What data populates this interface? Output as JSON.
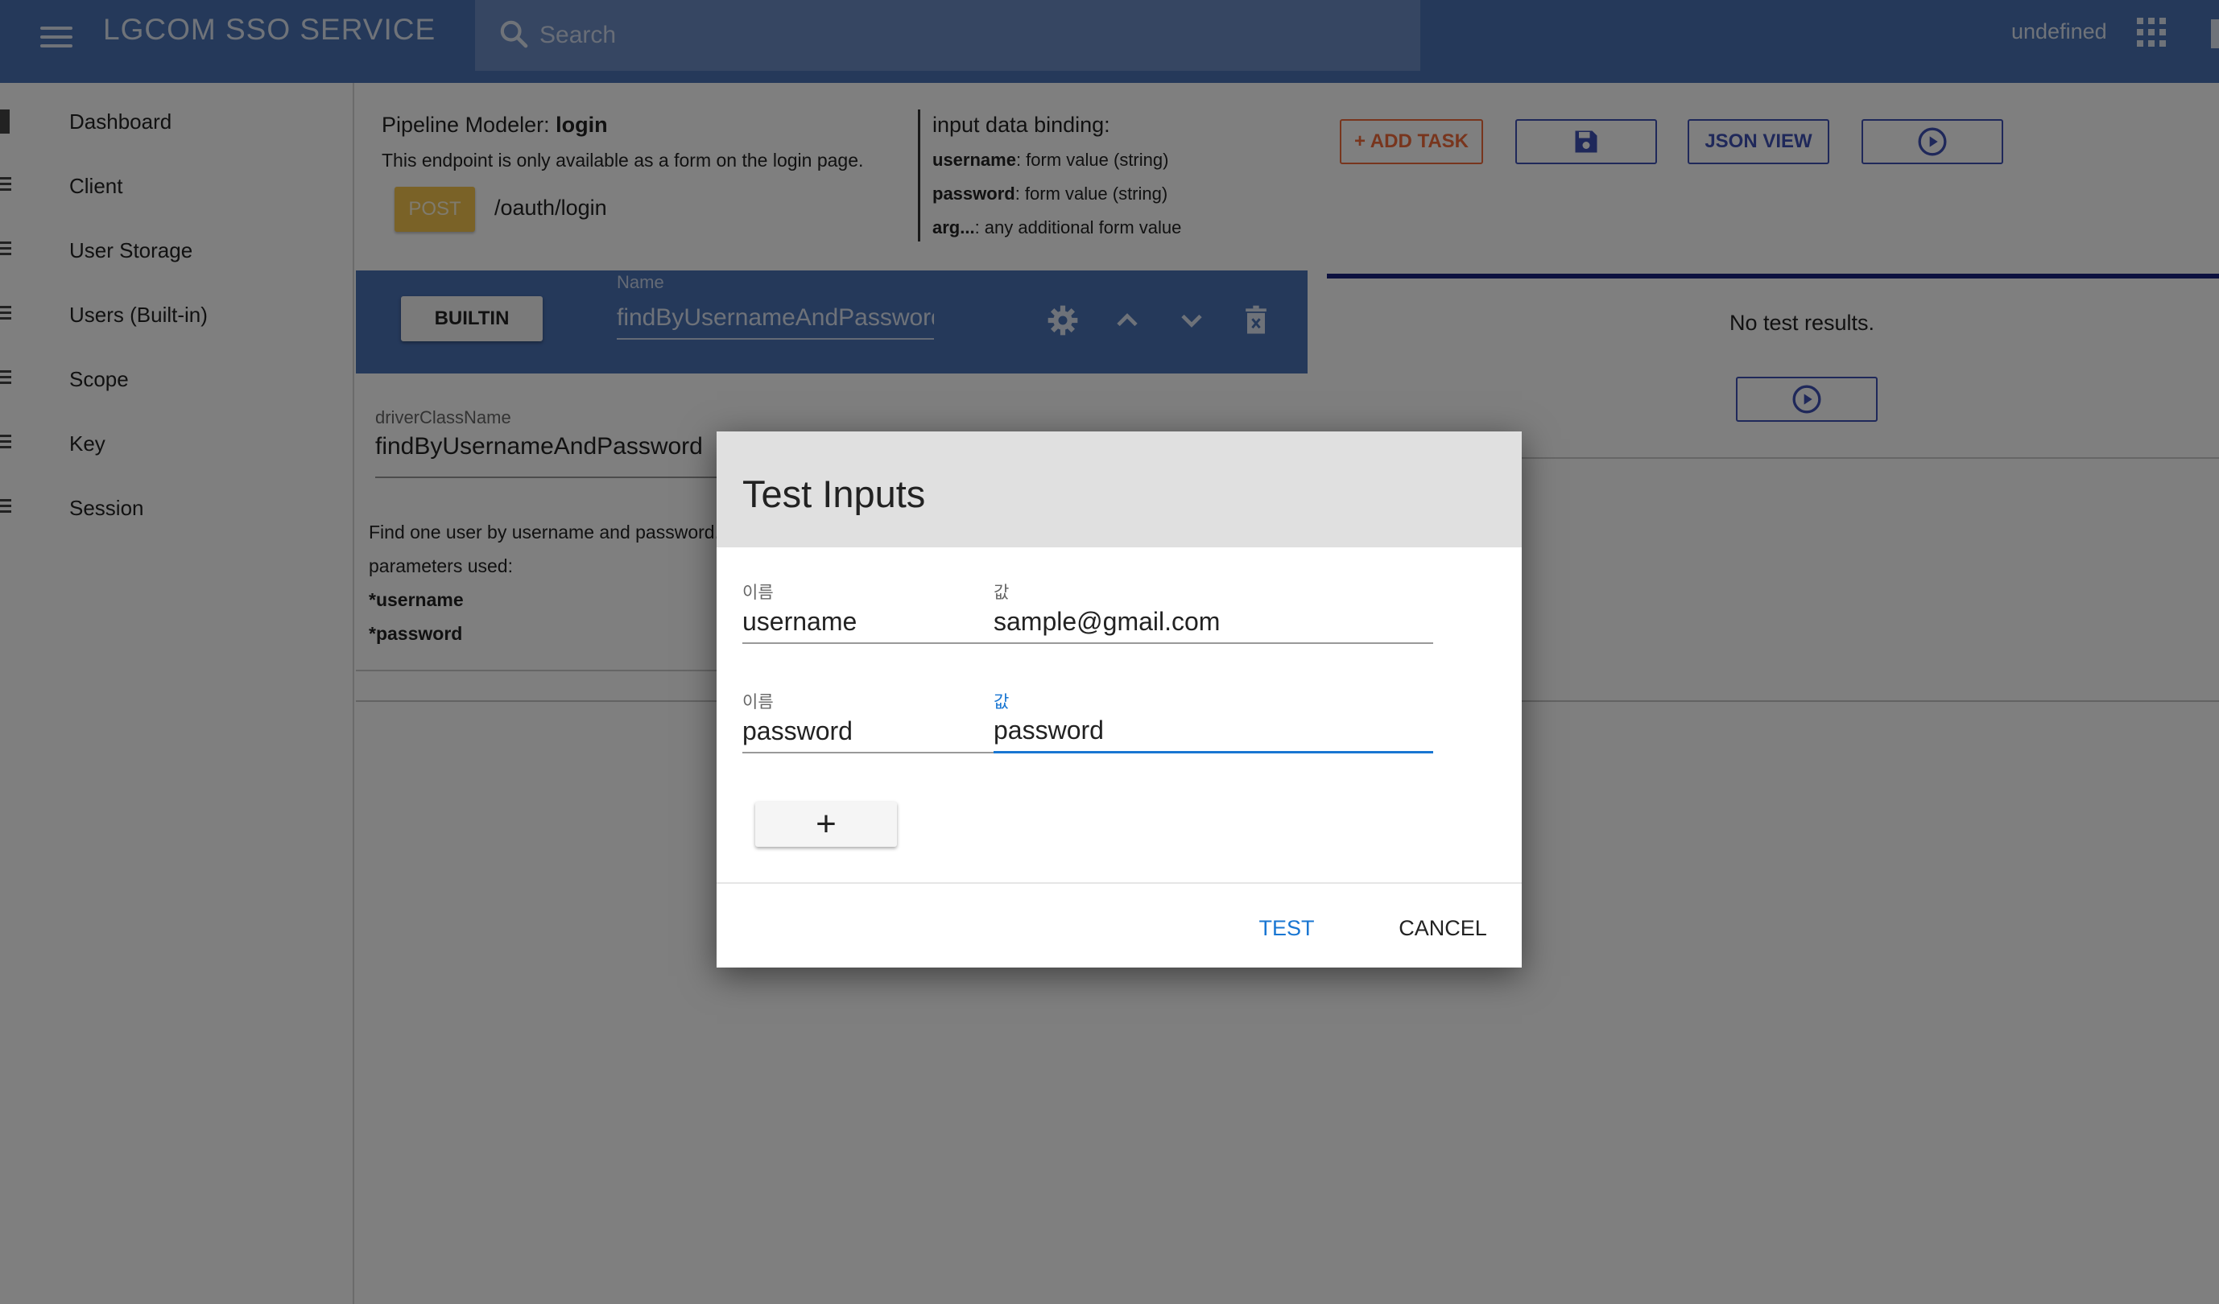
{
  "header": {
    "app_title": "LGCOM SSO SERVICE",
    "search_placeholder": "Search",
    "user_label": "undefined"
  },
  "sidebar": {
    "items": [
      {
        "label": "Dashboard"
      },
      {
        "label": "Client"
      },
      {
        "label": "User Storage"
      },
      {
        "label": "Users (Built-in)"
      },
      {
        "label": "Scope"
      },
      {
        "label": "Key"
      },
      {
        "label": "Session"
      }
    ]
  },
  "pipeline": {
    "title_prefix": "Pipeline Modeler: ",
    "title_name": "login",
    "description": "This endpoint is only available as a form on the login page.",
    "method": "POST",
    "path": "/oauth/login",
    "binding_title": "input data binding:",
    "bindings": [
      {
        "key": "username",
        "desc": ": form value (string)"
      },
      {
        "key": "password",
        "desc": ": form value (string)"
      },
      {
        "key": "arg...",
        "desc": ": any additional form value"
      }
    ]
  },
  "toolbar": {
    "add_task": "+ ADD TASK",
    "json_view": "JSON VIEW"
  },
  "task": {
    "type": "BUILTIN",
    "name_label": "Name",
    "name_value": "findByUsernameAndPassword",
    "driver_label": "driverClassName",
    "driver_value": "findByUsernameAndPassword",
    "desc_line1": "Find one user by username and password.",
    "desc_line2": "parameters used:",
    "param1": "*username",
    "param2": "*password"
  },
  "results": {
    "empty_text": "No test results."
  },
  "dialog": {
    "title": "Test Inputs",
    "rows": [
      {
        "name_label": "이름",
        "name": "username",
        "value_label": "값",
        "value": "sample@gmail.com"
      },
      {
        "name_label": "이름",
        "name": "password",
        "value_label": "값",
        "value": "password"
      }
    ],
    "add_label": "+",
    "test_label": "TEST",
    "cancel_label": "CANCEL"
  },
  "colors": {
    "brand": "#4a72b5",
    "accent": "#3f51b5",
    "add_task": "#f06a3a",
    "post_badge": "#f4c44e",
    "focus": "#1976d2"
  }
}
